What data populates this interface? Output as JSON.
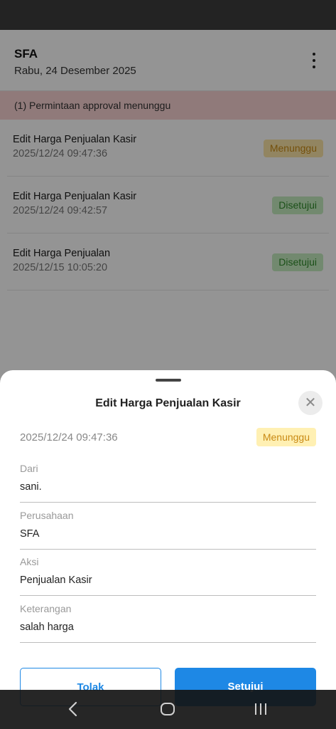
{
  "header": {
    "title": "SFA",
    "date": "Rabu, 24 Desember 2025"
  },
  "banner": {
    "text": "(1) Permintaan approval menunggu"
  },
  "requests": [
    {
      "title": "Edit Harga Penjualan Kasir",
      "time": "2025/12/24 09:47:36",
      "status": "Menunggu"
    },
    {
      "title": "Edit Harga Penjualan Kasir",
      "time": "2025/12/24 09:42:57",
      "status": "Disetujui"
    },
    {
      "title": "Edit Harga Penjualan",
      "time": "2025/12/15 10:05:20",
      "status": "Disetujui"
    }
  ],
  "sheet": {
    "title": "Edit Harga Penjualan Kasir",
    "time": "2025/12/24 09:47:36",
    "status": "Menunggu",
    "fields": [
      {
        "label": "Dari",
        "value": "sani."
      },
      {
        "label": "Perusahaan",
        "value": "SFA"
      },
      {
        "label": "Aksi",
        "value": "Penjualan Kasir"
      },
      {
        "label": "Keterangan",
        "value": "salah harga"
      }
    ],
    "reject_label": "Tolak",
    "approve_label": "Setujui"
  },
  "colors": {
    "primary": "#1e88e5",
    "pending_bg": "#fce6a8",
    "pending_text": "#c98a14",
    "approved_bg": "#c4ecc0",
    "approved_text": "#2f8a2a",
    "banner_bg": "#f8d3d3"
  },
  "icons": {
    "menu": "more-vert-icon",
    "close": "close-icon",
    "nav_back": "back-icon",
    "nav_home": "home-icon",
    "nav_recents": "recents-icon"
  }
}
